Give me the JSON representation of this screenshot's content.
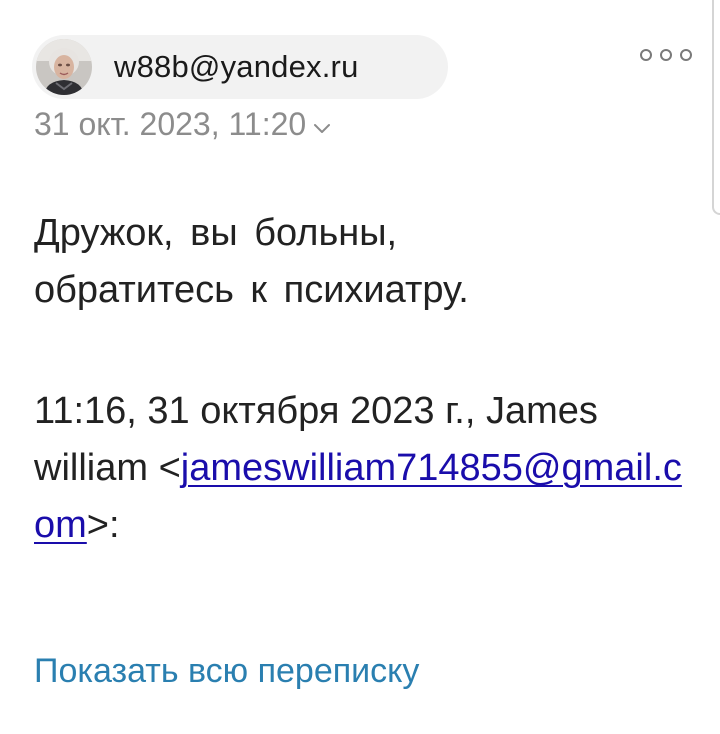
{
  "sender": {
    "email": "w88b@yandex.ru",
    "avatar_icon": "profile-photo"
  },
  "header": {
    "date": "31 окт. 2023, 11:20",
    "menu_icon": "more-options-icon"
  },
  "message": {
    "line1": "Дружок, вы больны,",
    "line2": "обратитесь к психиатру."
  },
  "quote": {
    "intro": "11:16, 31 октября 2023 г., James william",
    "open_bracket": "<",
    "email_link": "jameswilliam714855@gmail.com",
    "close": ">:"
  },
  "actions": {
    "show_thread": "Показать всю переписку"
  },
  "colors": {
    "link": "#1a0dab",
    "action": "#2a7fb0",
    "muted": "#8c8c8c",
    "chip_bg": "#f2f2f2"
  }
}
